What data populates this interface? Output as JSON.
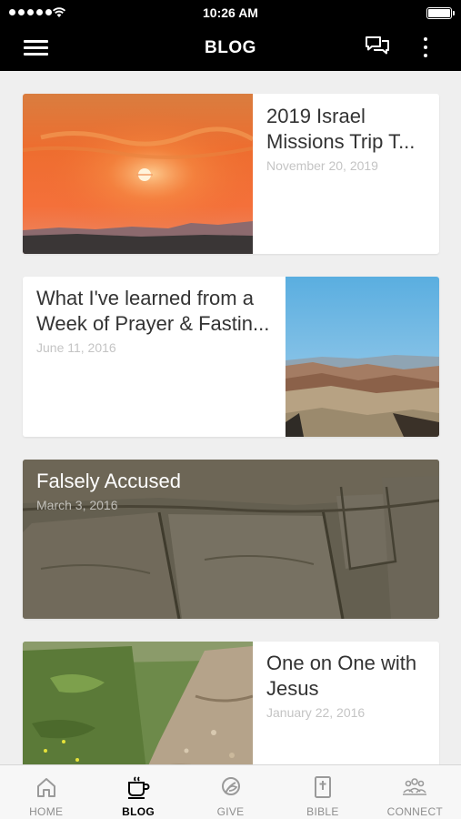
{
  "status_bar": {
    "time": "10:26 AM"
  },
  "nav": {
    "title": "BLOG"
  },
  "posts": [
    {
      "title": "2019 Israel Missions Trip T...",
      "date": "November 20, 2019"
    },
    {
      "title": "What I've learned from a Week of Prayer & Fastin...",
      "date": "June 11, 2016"
    },
    {
      "title": "Falsely Accused",
      "date": "March 3, 2016"
    },
    {
      "title": "One on One with Jesus",
      "date": "January 22, 2016"
    }
  ],
  "tabs": [
    {
      "label": "HOME",
      "icon": "home-icon",
      "active": false
    },
    {
      "label": "BLOG",
      "icon": "coffee-cup-icon",
      "active": true
    },
    {
      "label": "GIVE",
      "icon": "give-icon",
      "active": false
    },
    {
      "label": "BIBLE",
      "icon": "bible-icon",
      "active": false
    },
    {
      "label": "CONNECT",
      "icon": "people-icon",
      "active": false
    }
  ],
  "colors": {
    "bar_background": "#000000",
    "page_background": "#efefef",
    "active_tab": "#000000",
    "inactive_tab": "#8e8e8e"
  }
}
